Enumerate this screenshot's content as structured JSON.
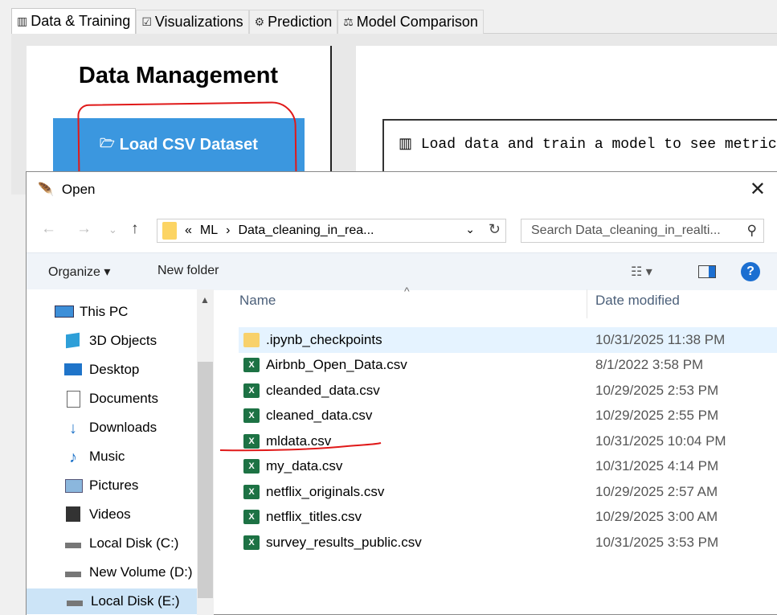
{
  "app": {
    "tabs": [
      {
        "label": "Data & Training",
        "icon": "bar-chart-icon"
      },
      {
        "label": "Visualizations",
        "icon": "checkbox-icon"
      },
      {
        "label": "Prediction",
        "icon": "gear-icon"
      },
      {
        "label": "Model Comparison",
        "icon": "scales-icon"
      }
    ],
    "section_title": "Data Management",
    "load_button": "Load CSV Dataset",
    "info_text": "Load data and train a model to see metrics"
  },
  "dialog": {
    "title": "Open",
    "address": {
      "prefix": "«",
      "segments": [
        "ML",
        "Data_cleaning_in_rea..."
      ]
    },
    "search_placeholder": "Search Data_cleaning_in_realti...",
    "toolbar": {
      "organize": "Organize ▾",
      "new_folder": "New folder"
    },
    "nav_tree": [
      {
        "label": "This PC",
        "icon": "pc-icon"
      },
      {
        "label": "3D Objects",
        "icon": "cube-icon"
      },
      {
        "label": "Desktop",
        "icon": "desktop-icon"
      },
      {
        "label": "Documents",
        "icon": "documents-icon"
      },
      {
        "label": "Downloads",
        "icon": "download-icon"
      },
      {
        "label": "Music",
        "icon": "music-icon"
      },
      {
        "label": "Pictures",
        "icon": "pictures-icon"
      },
      {
        "label": "Videos",
        "icon": "videos-icon"
      },
      {
        "label": "Local Disk (C:)",
        "icon": "drive-icon"
      },
      {
        "label": "New Volume (D:)",
        "icon": "drive-icon"
      },
      {
        "label": "Local Disk (E:)",
        "icon": "drive-icon"
      }
    ],
    "columns": {
      "name": "Name",
      "date": "Date modified"
    },
    "files": [
      {
        "name": ".ipynb_checkpoints",
        "date": "10/31/2025 11:38 PM",
        "type": "folder"
      },
      {
        "name": "Airbnb_Open_Data.csv",
        "date": "8/1/2022 3:58 PM",
        "type": "excel"
      },
      {
        "name": "cleanded_data.csv",
        "date": "10/29/2025 2:53 PM",
        "type": "excel"
      },
      {
        "name": "cleaned_data.csv",
        "date": "10/29/2025 2:55 PM",
        "type": "excel"
      },
      {
        "name": "mldata.csv",
        "date": "10/31/2025 10:04 PM",
        "type": "excel"
      },
      {
        "name": "my_data.csv",
        "date": "10/31/2025 4:14 PM",
        "type": "excel"
      },
      {
        "name": "netflix_originals.csv",
        "date": "10/29/2025 2:57 AM",
        "type": "excel"
      },
      {
        "name": "netflix_titles.csv",
        "date": "10/29/2025 3:00 AM",
        "type": "excel"
      },
      {
        "name": "survey_results_public.csv",
        "date": "10/31/2025 3:53 PM",
        "type": "excel"
      }
    ]
  },
  "colors": {
    "accent": "#3b97df",
    "annotation": "#e01919",
    "selection": "#cce4f7",
    "excel": "#1d7244"
  }
}
